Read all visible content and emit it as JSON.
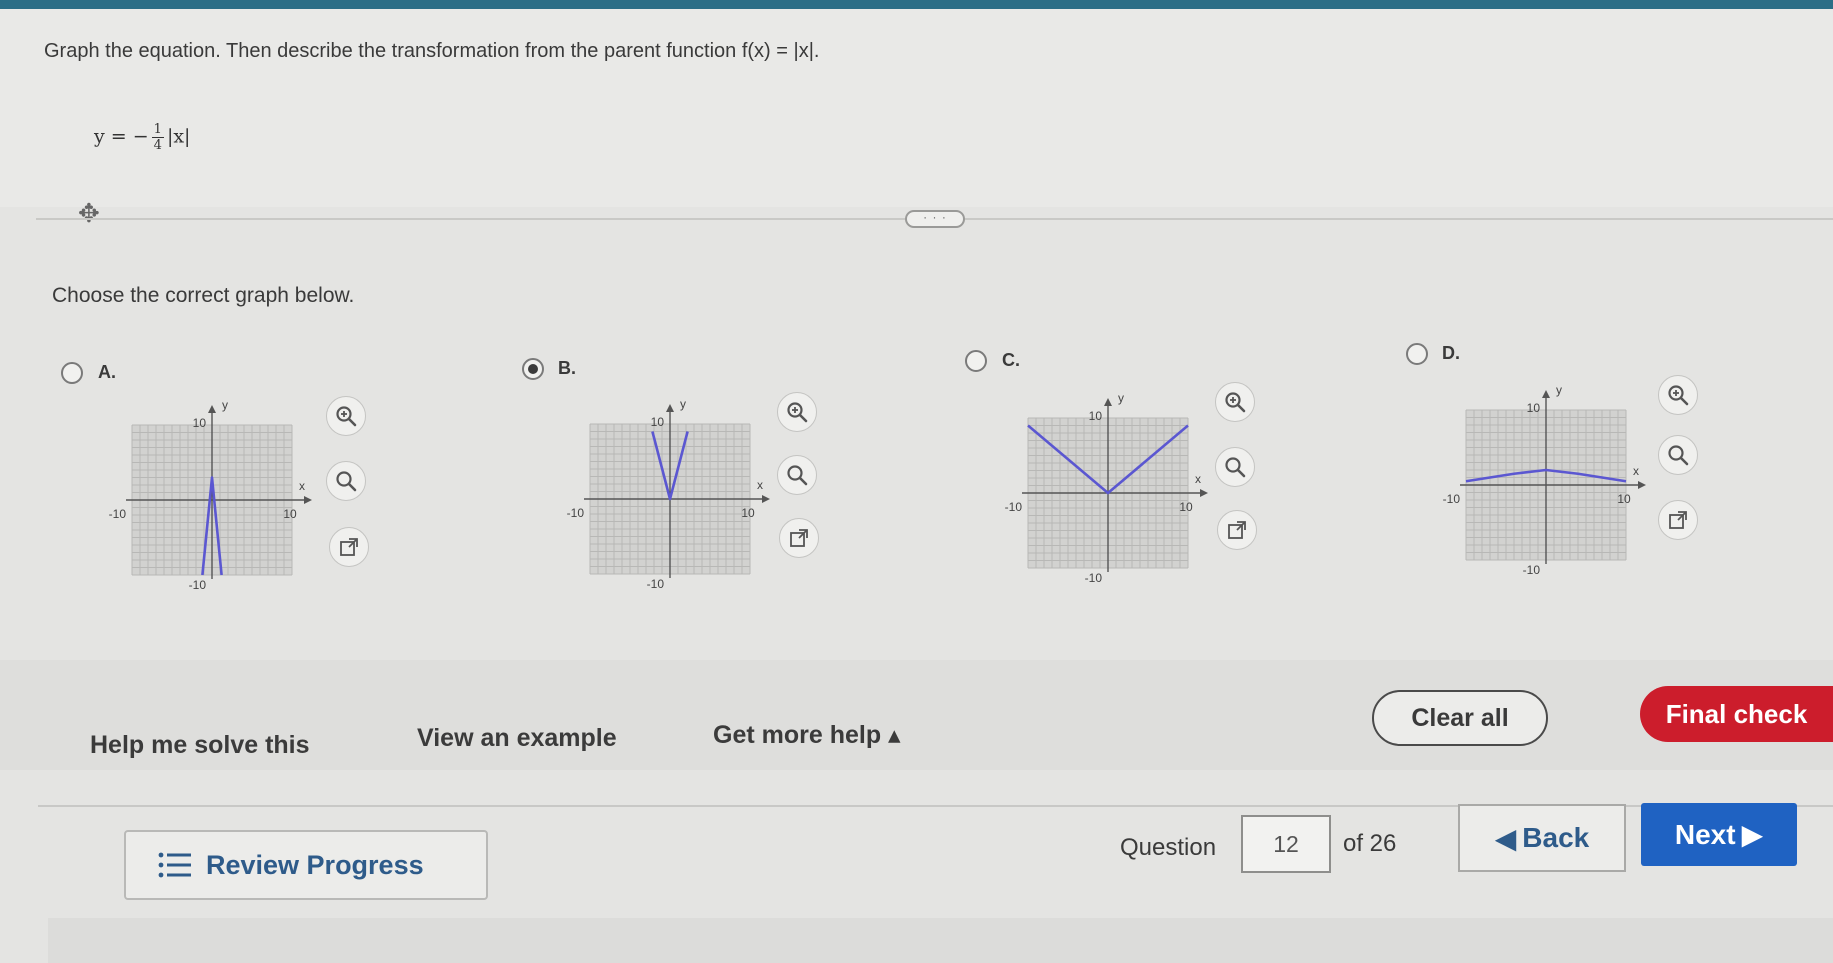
{
  "question": {
    "prompt": "Graph the equation. Then describe the transformation from the parent function f(x) = |x|.",
    "equation": {
      "lhs": "y = −",
      "numerator": "1",
      "denominator": "4",
      "rhs": "|x|"
    }
  },
  "divider": {
    "handle": "· · ·"
  },
  "instruction": "Choose the correct graph below.",
  "options": [
    {
      "letter": "A.",
      "selected": false,
      "xmin_label": "-10",
      "xmax_label": "10",
      "ymax_label": "10",
      "ymin_label": "-10",
      "x_axis_label": "x",
      "y_axis_label": "y"
    },
    {
      "letter": "B.",
      "selected": true,
      "xmin_label": "-10",
      "xmax_label": "10",
      "ymax_label": "10",
      "ymin_label": "-10",
      "x_axis_label": "x",
      "y_axis_label": "y"
    },
    {
      "letter": "C.",
      "selected": false,
      "xmin_label": "-10",
      "xmax_label": "10",
      "ymax_label": "10",
      "ymin_label": "-10",
      "x_axis_label": "x",
      "y_axis_label": "y"
    },
    {
      "letter": "D.",
      "selected": false,
      "xmin_label": "-10",
      "xmax_label": "10",
      "ymax_label": "10",
      "ymin_label": "-10",
      "x_axis_label": "x",
      "y_axis_label": "y"
    }
  ],
  "help": {
    "solve": "Help me solve this",
    "example": "View an example",
    "more": "Get more help ▴"
  },
  "actions": {
    "clear": "Clear all",
    "final": "Final check"
  },
  "nav": {
    "review": "Review Progress",
    "question_label": "Question",
    "current": "12",
    "of_label": "of 26",
    "back": "Back",
    "next": "Next"
  },
  "colors": {
    "accent": "#1f62c2",
    "final": "#cc1d2c",
    "curve": "#5b57d1",
    "topbar": "#2c6e86"
  },
  "icons": [
    "move-icon",
    "zoom-in-icon",
    "zoom-out-icon",
    "popout-icon",
    "list-icon",
    "caret-left-icon",
    "caret-right-icon"
  ]
}
